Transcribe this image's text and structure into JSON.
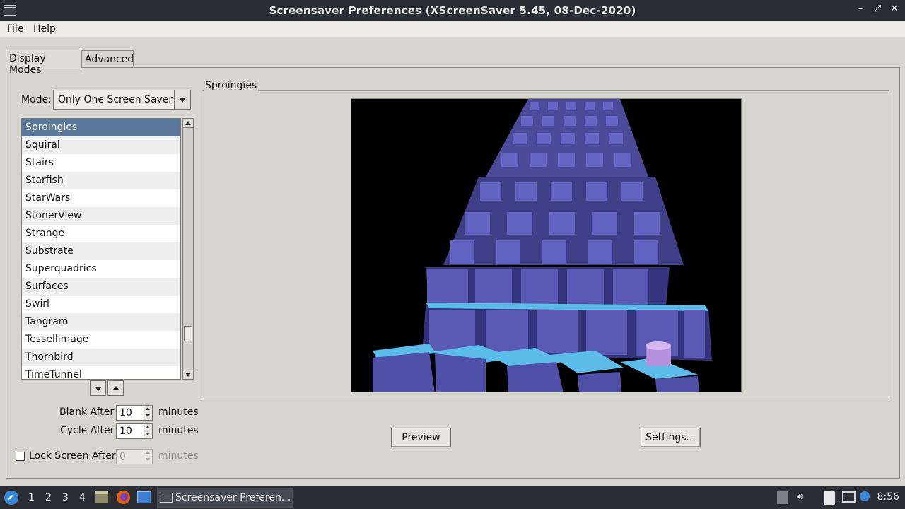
{
  "window": {
    "title": "Screensaver Preferences  (XScreenSaver 5.45, 08-Dec-2020)"
  },
  "menu": {
    "file": "File",
    "help": "Help"
  },
  "tabs": [
    {
      "label": "Display Modes"
    },
    {
      "label": "Advanced"
    }
  ],
  "mode": {
    "label": "Mode:",
    "value": "Only One Screen Saver"
  },
  "list": {
    "selected": "Sproingies",
    "items": [
      "Sproingies",
      "Squiral",
      "Stairs",
      "Starfish",
      "StarWars",
      "StonerView",
      "Strange",
      "Substrate",
      "Superquadrics",
      "Surfaces",
      "Swirl",
      "Tangram",
      "Tessellimage",
      "Thornbird",
      "TimeTunnel"
    ]
  },
  "blank": {
    "label": "Blank After",
    "value": "10",
    "unit": "minutes"
  },
  "cycle": {
    "label": "Cycle After",
    "value": "10",
    "unit": "minutes"
  },
  "lock": {
    "label": "Lock Screen After",
    "value": "0",
    "unit": "minutes",
    "checked": false
  },
  "preview_frame": {
    "title": "Sproingies"
  },
  "buttons": {
    "preview": "Preview",
    "settings": "Settings..."
  },
  "taskbar": {
    "workspaces": [
      "1",
      "2",
      "3",
      "4"
    ],
    "active_task": "Screensaver Preferen...",
    "clock": "8:56"
  },
  "colors": {
    "selection": "#5a7899",
    "titlebar": "#2a2e34",
    "cube_top": "#5bbbe9",
    "cube_side": "#5a5ab4"
  }
}
